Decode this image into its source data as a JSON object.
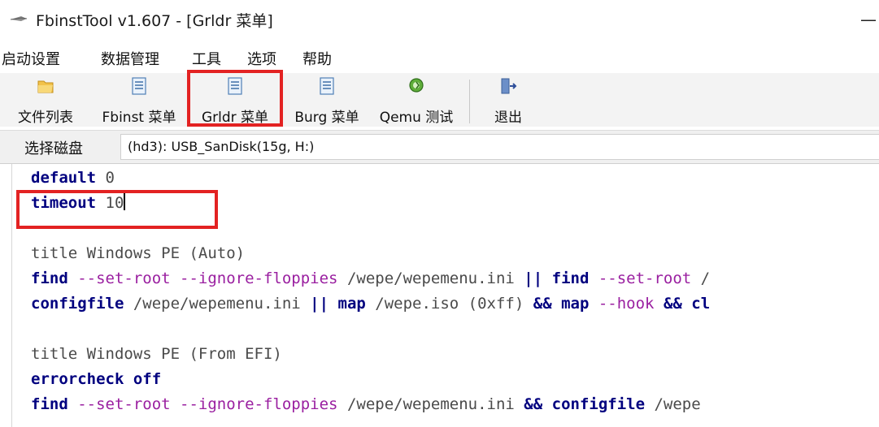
{
  "window": {
    "title": "FbinstTool v1.607 - [Grldr 菜单]",
    "minimize_glyph": "—"
  },
  "menubar": {
    "items": [
      "启动设置",
      "数据管理",
      "工具",
      "选项",
      "帮助"
    ]
  },
  "toolbar": {
    "buttons": [
      {
        "label": "文件列表",
        "icon": "folder-icon"
      },
      {
        "label": "Fbinst 菜单",
        "icon": "document-icon"
      },
      {
        "label": "Grldr 菜单",
        "icon": "document-icon",
        "highlighted": true
      },
      {
        "label": "Burg 菜单",
        "icon": "document-icon"
      },
      {
        "label": "Qemu 测试",
        "icon": "qemu-icon"
      },
      {
        "label": "退出",
        "icon": "exit-door-icon"
      }
    ]
  },
  "disk": {
    "label": "选择磁盘",
    "value": "(hd3): USB_SanDisk(15g, H:)"
  },
  "editor": {
    "highlight_color": "#e32222",
    "lines": {
      "l0": {
        "cmd": "default",
        "arg": " 0"
      },
      "l1": {
        "cmd": "timeout",
        "arg": " 10"
      },
      "l3": {
        "text": "title Windows PE (Auto)"
      },
      "l4": {
        "p1": "find",
        "p2": " --set-root --ignore-floppies",
        "p3": " /wepe/wepemenu.ini ",
        "p4": "||",
        "p5": " ",
        "p6": "find",
        "p7": " --set-root",
        "p8": " /"
      },
      "l5": {
        "p1": "configfile",
        "p2": " /wepe/wepemenu.ini ",
        "p3": "||",
        "p4": " ",
        "p5": "map",
        "p6": " /wepe.iso (0xff) ",
        "p7": "&&",
        "p8": " ",
        "p9": "map",
        "p10": " --hook",
        "p11": " ",
        "p12": "&&",
        "p13": " ",
        "p14": "cl"
      },
      "l7": {
        "text": "title Windows PE (From EFI)"
      },
      "l8": {
        "p1": "errorcheck",
        "p2": " off"
      },
      "l9": {
        "p1": "find",
        "p2": " --set-root --ignore-floppies",
        "p3": " /wepe/wepemenu.ini ",
        "p4": "&&",
        "p5": " ",
        "p6": "configfile",
        "p7": " /wepe"
      }
    }
  }
}
